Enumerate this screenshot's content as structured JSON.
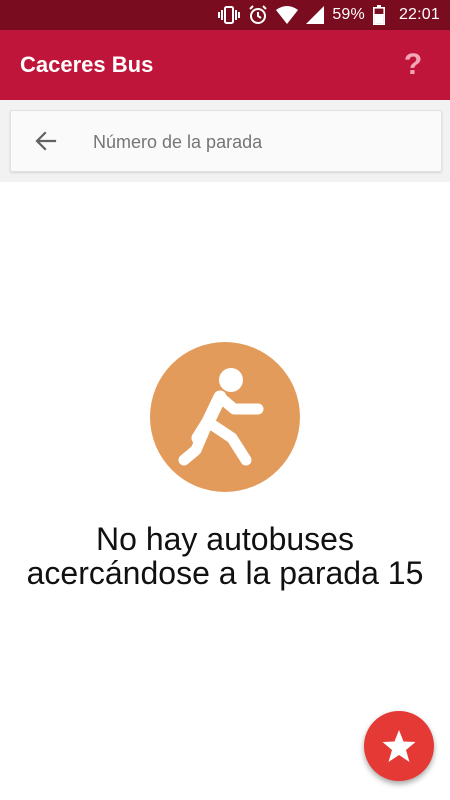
{
  "status_bar": {
    "battery_percent": "59%",
    "time": "22:01",
    "background_color": "#7a0c1f",
    "icons": [
      "vibrate-icon",
      "alarm-icon",
      "wifi-icon",
      "signal-icon",
      "battery-icon"
    ]
  },
  "app_bar": {
    "title": "Caceres Bus",
    "help_label": "?",
    "background_color": "#c0153a"
  },
  "search": {
    "placeholder": "Número de la parada",
    "value": "",
    "back_icon": "arrow-back-icon"
  },
  "empty_state": {
    "icon": "walking-person-icon",
    "icon_circle_color": "#e39b5b",
    "message": "No hay autobuses acercándose a la parada 15"
  },
  "fab": {
    "icon": "star-icon",
    "color": "#e53935"
  }
}
